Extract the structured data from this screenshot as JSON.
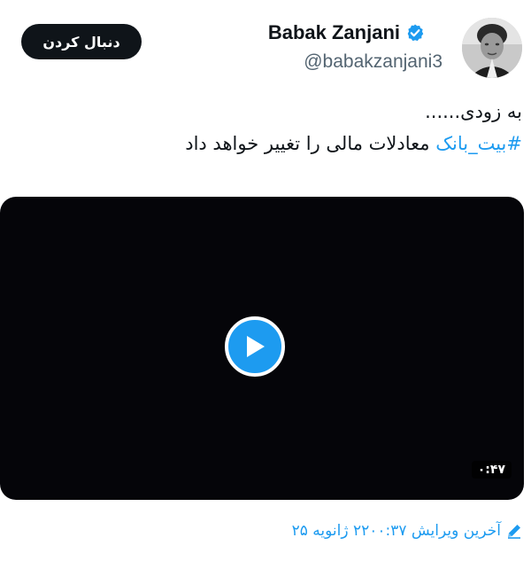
{
  "follow_button": {
    "label": "دنبال کردن"
  },
  "author": {
    "display_name": "Babak Zanjani",
    "handle": "@babakzanjani3",
    "verified_badge_icon": "verified-check-icon"
  },
  "tweet": {
    "line1": "به زودی......",
    "hashtag": "#بیت_بانک",
    "line2_rest": " معادلات مالی را تغییر خواهد داد"
  },
  "video": {
    "duration": "۰:۴۷",
    "play_icon": "play-icon"
  },
  "edited": {
    "icon": "pencil-icon",
    "label": "آخرین ویرایش ۲۲۰۰:۳۷ ژانویه ۲۵"
  },
  "colors": {
    "accent": "#1d9bf0",
    "text": "#0f1419",
    "secondary_text": "#536471",
    "video_bg": "#050509"
  }
}
